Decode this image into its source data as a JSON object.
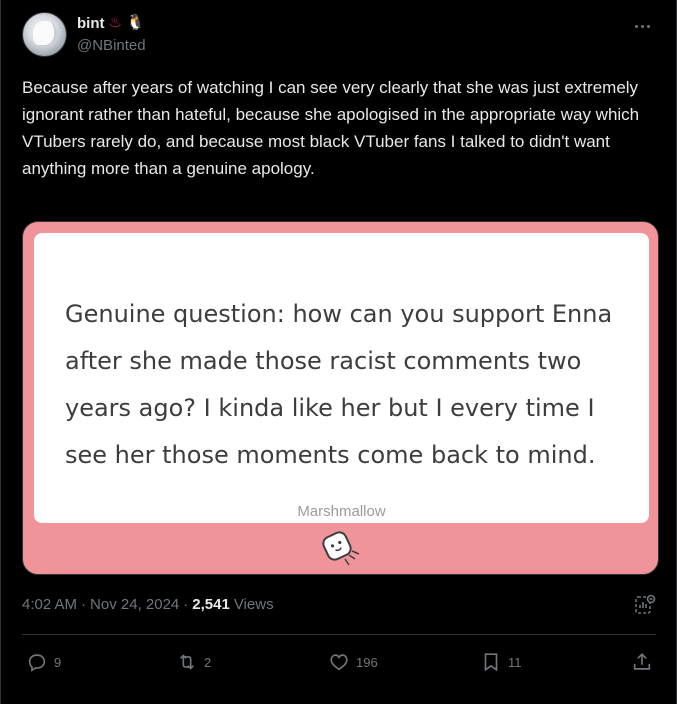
{
  "author": {
    "display_name": "bint",
    "emoji_1": "♨",
    "emoji_2": "🐧",
    "handle": "@NBinted"
  },
  "tweet": {
    "text": "Because after years of watching I can see very clearly that she was just extremely ignorant rather than hateful, because she apologised in the appropriate way which VTubers rarely do, and because most black VTuber fans I talked to didn't want anything more than a genuine apology."
  },
  "media": {
    "question_text": "Genuine question: how can you support Enna after she made those racist comments two years ago? I kinda like her but I every time I see her those moments come back to mind.",
    "watermark": "Marshmallow",
    "background_color": "#f1949a"
  },
  "meta": {
    "time": "4:02 AM",
    "separator_1": "·",
    "date": "Nov 24, 2024",
    "separator_2": "·",
    "views_count": "2,541",
    "views_label": "Views"
  },
  "actions": {
    "replies": "9",
    "reposts": "2",
    "likes": "196",
    "bookmarks": "11"
  },
  "icons": [
    "more-icon",
    "analytics-icon",
    "reply-icon",
    "repost-icon",
    "like-icon",
    "bookmark-icon",
    "share-icon"
  ]
}
